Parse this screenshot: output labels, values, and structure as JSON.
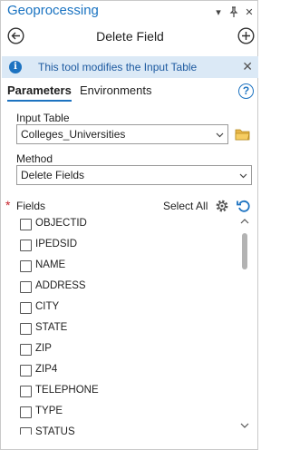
{
  "pane": {
    "title": "Geoprocessing",
    "options_glyph": "▾",
    "pin_glyph": "📌",
    "close_glyph": "✕"
  },
  "tool": {
    "title": "Delete Field"
  },
  "banner": {
    "text": "This tool modifies the Input Table",
    "icon": "i",
    "close_glyph": "✕"
  },
  "tabs": {
    "parameters": "Parameters",
    "environments": "Environments",
    "help": "?"
  },
  "params": {
    "input_table_label": "Input Table",
    "input_table_value": "Colleges_Universities",
    "method_label": "Method",
    "method_value": "Delete Fields",
    "fields_label": "Fields",
    "required_mark": "*",
    "select_all": "Select All"
  },
  "fields": [
    "OBJECTID",
    "IPEDSID",
    "NAME",
    "ADDRESS",
    "CITY",
    "STATE",
    "ZIP",
    "ZIP4",
    "TELEPHONE",
    "TYPE",
    "STATUS"
  ],
  "colors": {
    "accent": "#1d73c1",
    "banner_bg": "#dbe9f6",
    "required": "#c8232c"
  }
}
